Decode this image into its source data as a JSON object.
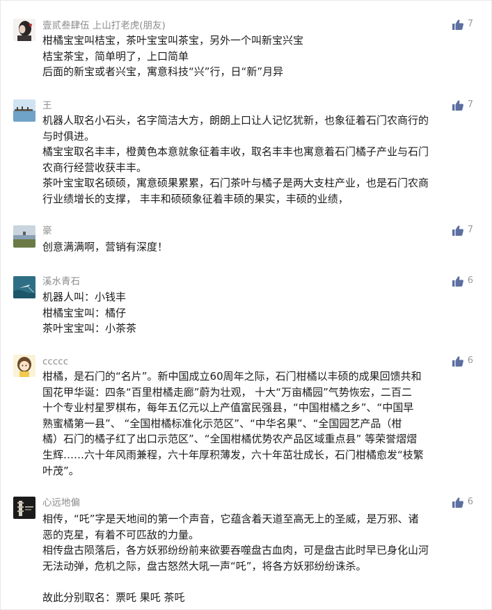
{
  "comments": [
    {
      "nickname": "壹贰叁肆伍 上山打老虎(朋友)",
      "likes": "7",
      "avatar_icon": "girl-profile-avatar",
      "lines": [
        "柑橘宝宝叫桔宝，茶叶宝宝叫茶宝，另外一个叫新宝兴宝",
        "桔宝茶宝，简单明了，上口简单",
        "后面的新宝或者兴宝，寓意科技“兴”行，日“新”月异"
      ]
    },
    {
      "nickname": "王",
      "likes": "7",
      "avatar_icon": "seaside-pier-avatar",
      "lines": [
        "机器人取名小石头，名字简洁大方，朗朗上口让人记忆犹新，也象征着石门农商行的",
        "与时俱进。",
        "橘宝宝取名丰丰，橙黄色本意就象征着丰收，取名丰丰也寓意着石门橘子产业与石门",
        "农商行经营收获丰丰。",
        "茶叶宝宝取名硕硕，寓意硕果累累，石门茶叶与橘子是两大支柱产业，也是石门农商",
        "行业绩增长的支撑， 丰丰和硕硕象征着丰硕的果实，丰硕的业绩，"
      ]
    },
    {
      "nickname": "豪",
      "likes": "7",
      "avatar_icon": "lakeside-landscape-avatar",
      "lines": [
        "创意满满啊，营销有深度！"
      ]
    },
    {
      "nickname": "溪水青石",
      "likes": "6",
      "avatar_icon": "boat-on-water-avatar",
      "lines": [
        "机器人叫：小钱丰",
        "柑橘宝宝叫：橘仔",
        "茶叶宝宝叫：小茶茶"
      ]
    },
    {
      "nickname": "ccccc",
      "likes": "6",
      "avatar_icon": "cartoon-girl-avatar",
      "lines": [
        "柑橘，是石门的“名片”。新中国成立60周年之际，石门柑橘以丰硕的成果回馈共和",
        "国花甲华诞：四条“百里柑橘走廊”蔚为壮观， 十大“万亩橘园”气势恢宏，二百二",
        "十个专业村星罗棋布，每年五亿元以上产值富民强县，“中国柑橘之乡”、“中国早",
        "熟蜜橘第一县”、 “全国柑橘标准化示范区”、“中华名果”、“全国园艺产品（柑",
        "橘）石门的橘子红了出口示范区”、“全国柑橘优势农产品区域重点县” 等荣誉熠熠",
        "生辉……六十年风雨兼程，六十年厚积薄发，六十年茁壮成长，石门柑橘愈发“枝繁",
        "叶茂”。"
      ]
    },
    {
      "nickname": "心远地偏",
      "likes": "6",
      "avatar_icon": "pagoda-night-avatar",
      "lines": [
        "相传，“吒”字是天地间的第一个声音，它蕴含着天道至高无上的圣威，是万邪、诸",
        "恶的克星，有着不可匹敌的力量。",
        "相传盘古陨落后，各方妖邪纷纷前来欲要吞噬盘古血肉，可是盘古此时早已身化山河",
        "无法动弹，危机之际，盘古怒然大吼一声“吒”，将各方妖邪纷纷诛杀。",
        "",
        "故此分别取名：票吒 果吒 茶吒"
      ]
    }
  ],
  "colors": {
    "like_icon": "#5b6fa0",
    "nickname": "#8c8c8c",
    "text": "#1c1c1c"
  }
}
